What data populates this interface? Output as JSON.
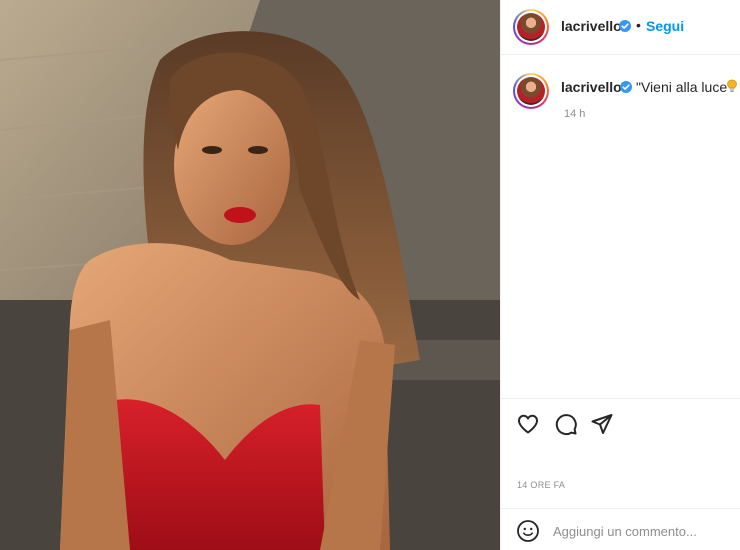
{
  "post": {
    "username": "lacrivello",
    "separator": "•",
    "follow_label": "Segui",
    "caption": "\"Vieni alla luce\"",
    "comment_age": "14 h",
    "timestamp": "14 ORE FA"
  },
  "icons": {
    "header_avatar": "avatar",
    "verified": "verified-badge-icon",
    "like": "heart-icon",
    "comment": "comment-bubble-icon",
    "share": "paper-plane-icon",
    "emoji": "emoji-smiley-icon",
    "caption_emoji": "light-bulb-icon"
  },
  "comment_box": {
    "placeholder": "Aggiungi un commento..."
  },
  "colors": {
    "link_blue": "#0095f6",
    "verified_blue": "#3897f0",
    "swimsuit_red": "#c8141e",
    "muted_text": "#8e8e8e"
  }
}
